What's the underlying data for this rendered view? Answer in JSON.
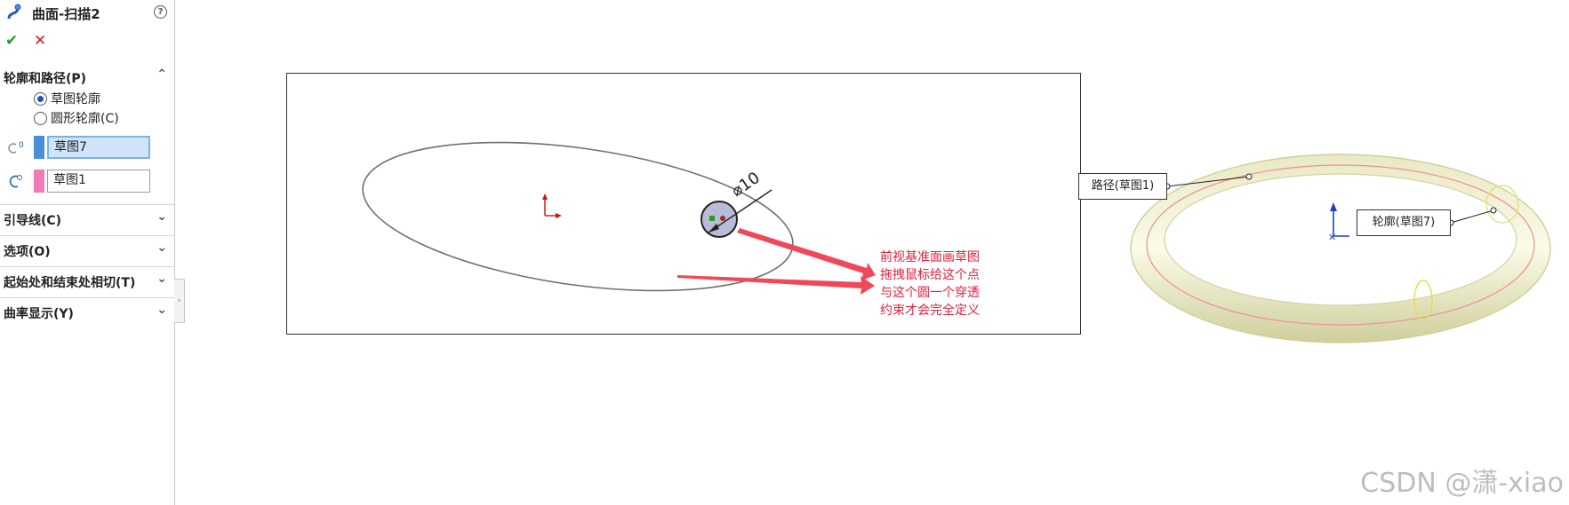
{
  "panel": {
    "title": "曲面-扫描2",
    "help_glyph": "?",
    "ok_glyph": "✔",
    "cancel_glyph": "✕",
    "sections": [
      {
        "label": "轮廓和路径(P)",
        "chevron": "⌃"
      },
      {
        "label": "引导线(C)",
        "chevron": "⌄"
      },
      {
        "label": "选项(O)",
        "chevron": "⌄"
      },
      {
        "label": "起始处和结束处相切(T)",
        "chevron": "⌄"
      },
      {
        "label": "曲率显示(Y)",
        "chevron": "⌄"
      }
    ],
    "radio_sketch_profile": "草图轮廓",
    "radio_circular_profile": "圆形轮廓(C)",
    "profile_selection": "草图7",
    "path_selection": "草图1",
    "profile_swatch_color": "#4a90d9",
    "path_swatch_color": "#f07ab8",
    "icons": [
      "sweep-icon",
      "help-icon",
      "check-icon",
      "close-icon",
      "profile-icon",
      "path-icon"
    ]
  },
  "sketch": {
    "dimension": "⌀10",
    "annotation_lines": [
      "前视基准面画草图",
      "拖拽鼠标给这个点",
      "与这个圆一个穿透",
      "约束才会完全定义"
    ],
    "annotation_color": "#e4203c"
  },
  "preview": {
    "path_callout": "路径(草图1)",
    "profile_callout": "轮廓(草图7)"
  },
  "watermark": "CSDN @潇-xiao"
}
